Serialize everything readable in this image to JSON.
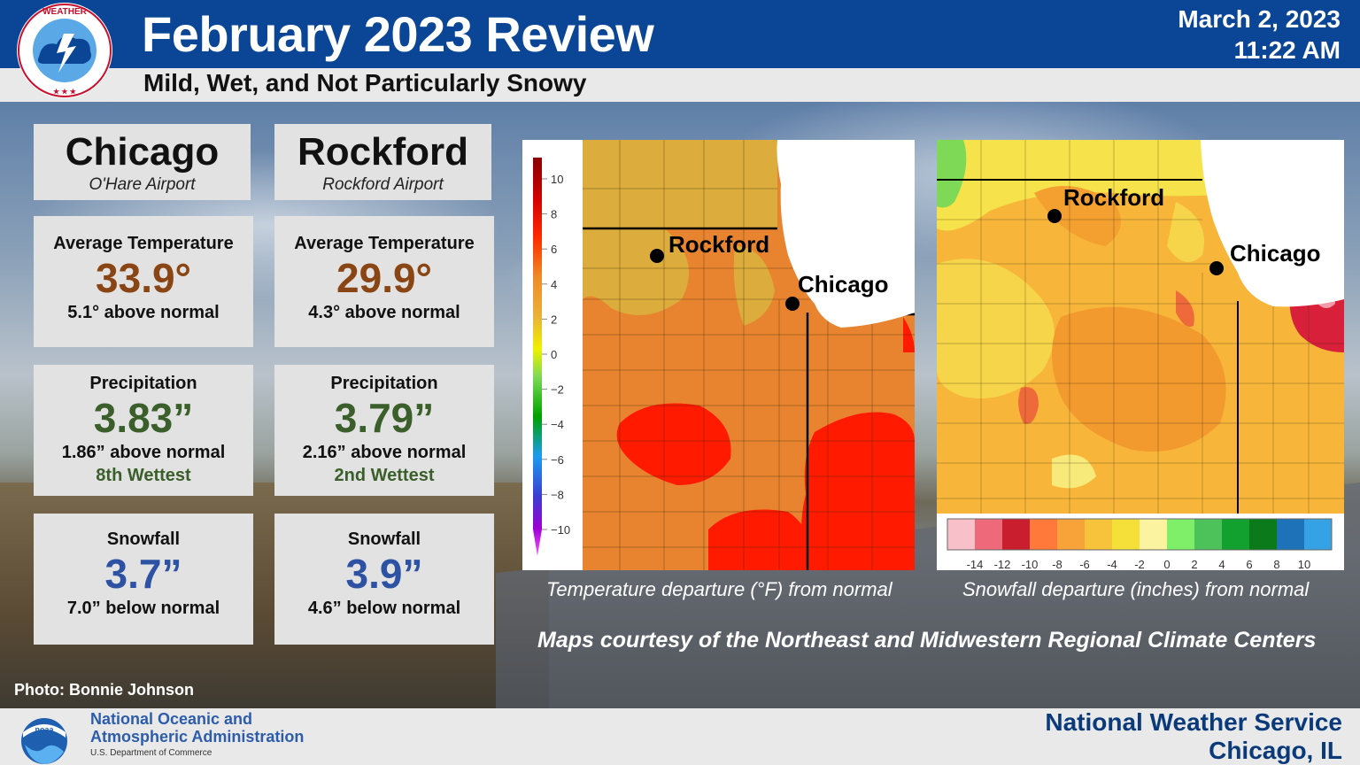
{
  "header": {
    "title": "February 2023 Review",
    "subtitle": "Mild, Wet, and Not Particularly Snowy",
    "date": "March 2, 2023",
    "time": "11:22 AM"
  },
  "cities": [
    {
      "name": "Chicago",
      "site": "O'Hare Airport",
      "temperature": {
        "label": "Average Temperature",
        "value": "33.9°",
        "note": "5.1° above normal"
      },
      "precipitation": {
        "label": "Precipitation",
        "value": "3.83”",
        "note": "1.86” above normal",
        "rank": "8th Wettest"
      },
      "snowfall": {
        "label": "Snowfall",
        "value": "3.7”",
        "note": "7.0” below normal"
      }
    },
    {
      "name": "Rockford",
      "site": "Rockford Airport",
      "temperature": {
        "label": "Average Temperature",
        "value": "29.9°",
        "note": "4.3° above normal"
      },
      "precipitation": {
        "label": "Precipitation",
        "value": "3.79”",
        "note": "2.16” above normal",
        "rank": "2nd Wettest"
      },
      "snowfall": {
        "label": "Snowfall",
        "value": "3.9”",
        "note": "4.6” below normal"
      }
    }
  ],
  "maps": {
    "temperature": {
      "caption": "Temperature departure (°F) from normal",
      "city_labels": [
        "Rockford",
        "Chicago"
      ],
      "legend_ticks": [
        "10",
        "8",
        "6",
        "4",
        "2",
        "0",
        "−2",
        "−4",
        "−6",
        "−8",
        "−10"
      ]
    },
    "snowfall": {
      "caption": "Snowfall departure (inches) from normal",
      "city_labels": [
        "Rockford",
        "Chicago"
      ],
      "legend_ticks": [
        "-14",
        "-12",
        "-10",
        "-8",
        "-6",
        "-4",
        "-2",
        "0",
        "2",
        "4",
        "6",
        "8",
        "10"
      ]
    },
    "credits": "Maps courtesy of the Northeast and Midwestern Regional Climate Centers"
  },
  "photo_credit": "Photo: Bonnie Johnson",
  "footer": {
    "noaa_line1": "National Oceanic and",
    "noaa_line2": "Atmospheric Administration",
    "noaa_dept": "U.S. Department of Commerce",
    "nws_line1": "National Weather Service",
    "nws_line2": "Chicago, IL"
  },
  "colors": {
    "header_blue": "#0a4695",
    "temperature_value": "#8a4514",
    "precipitation_value": "#3a5f2a",
    "snowfall_value": "#2d52a3"
  }
}
